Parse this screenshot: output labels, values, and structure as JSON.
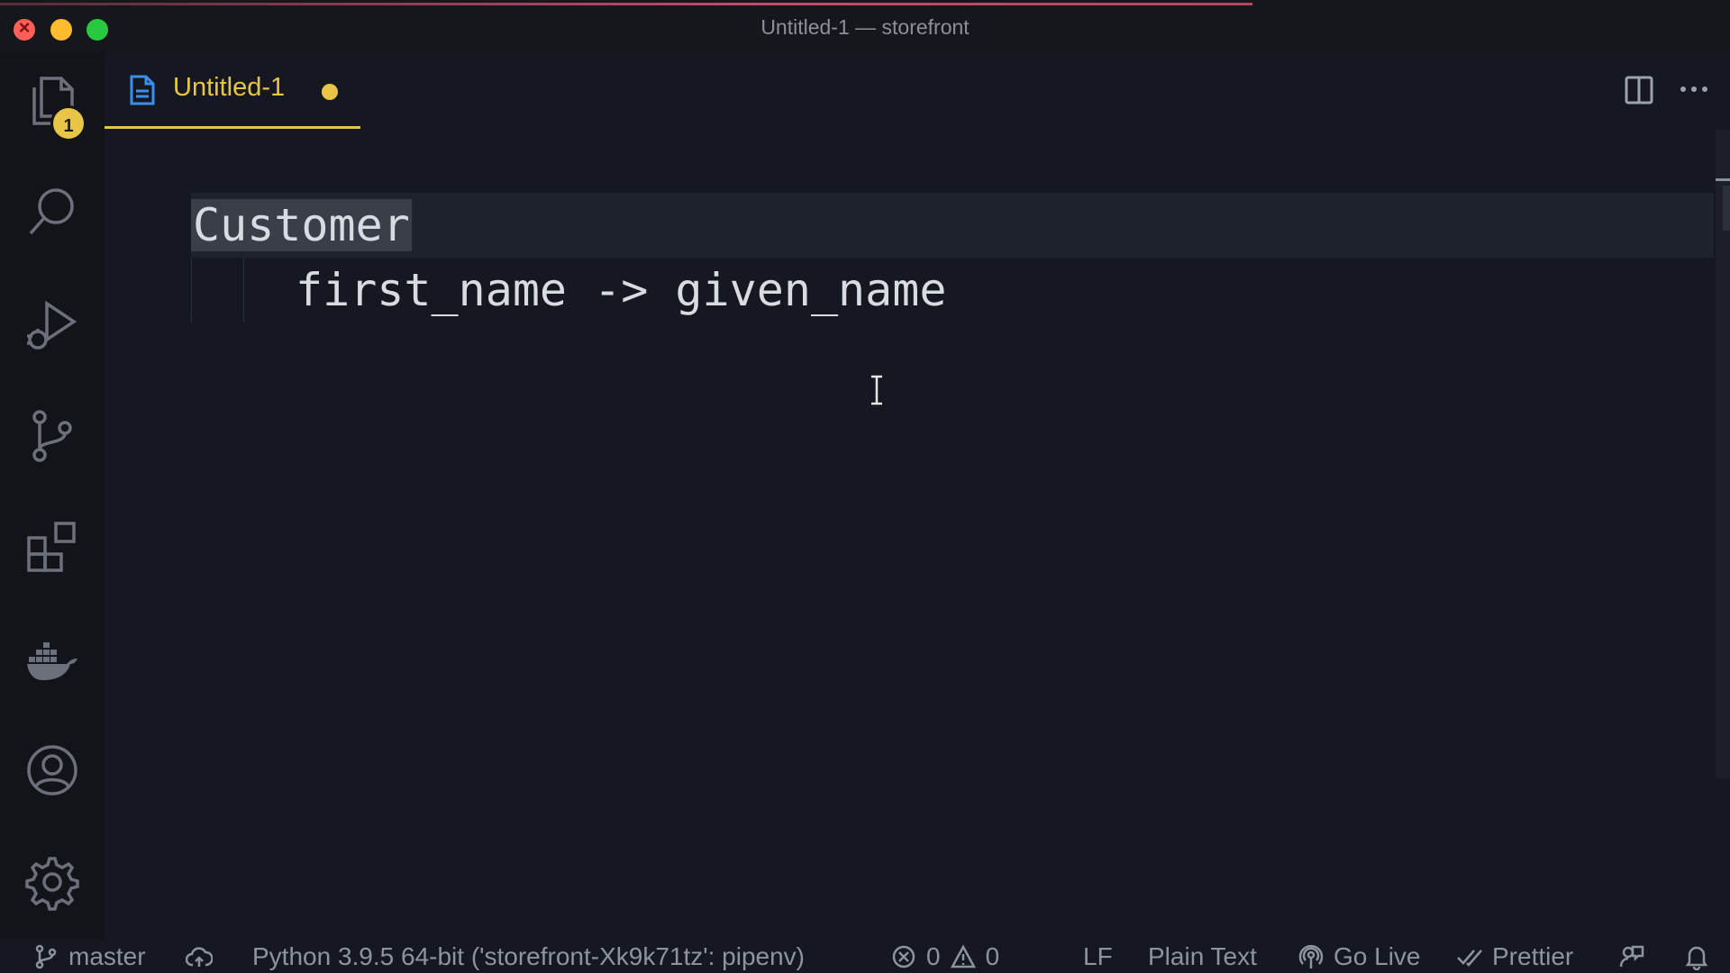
{
  "window": {
    "title": "Untitled-1 — storefront"
  },
  "activity_bar": {
    "explorer_badge": "1",
    "icons": [
      "files-icon",
      "search-icon",
      "run-debug-icon",
      "source-control-icon",
      "extensions-icon",
      "docker-icon",
      "account-icon",
      "settings-gear-icon"
    ]
  },
  "tabs": [
    {
      "label": "Untitled-1",
      "modified": true
    }
  ],
  "editor": {
    "lines": [
      {
        "selected_word": "Customer"
      },
      {
        "text": "first_name -> given_name"
      }
    ]
  },
  "status_bar": {
    "branch": "master",
    "interpreter": "Python 3.9.5 64-bit ('storefront-Xk9k71tz': pipenv)",
    "errors": "0",
    "warnings": "0",
    "eol": "LF",
    "language": "Plain Text",
    "go_live": "Go Live",
    "prettier": "Prettier"
  },
  "colors": {
    "accent": "#e8c547",
    "background": "#151820",
    "activity_bar": "#12141a"
  }
}
